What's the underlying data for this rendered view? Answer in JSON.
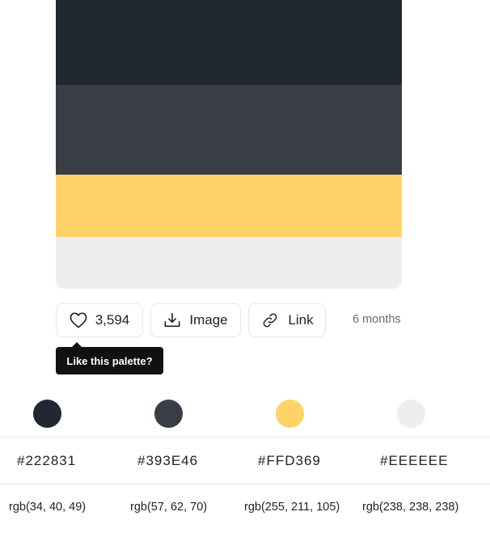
{
  "palette": {
    "colors": [
      "#222831",
      "#393E46",
      "#FFD369",
      "#EEEEEE"
    ]
  },
  "actions": {
    "likes": "3,594",
    "image_label": "Image",
    "link_label": "Link",
    "time_ago": "6 months"
  },
  "tooltip": {
    "text": "Like this palette?"
  },
  "details": [
    {
      "hex": "#222831",
      "rgb": "rgb(34, 40, 49)"
    },
    {
      "hex": "#393E46",
      "rgb": "rgb(57, 62, 70)"
    },
    {
      "hex": "#FFD369",
      "rgb": "rgb(255, 211, 105)"
    },
    {
      "hex": "#EEEEEE",
      "rgb": "rgb(238, 238, 238)"
    }
  ],
  "icons": {
    "like": "heart-icon",
    "image": "download-icon",
    "link": "link-icon"
  }
}
